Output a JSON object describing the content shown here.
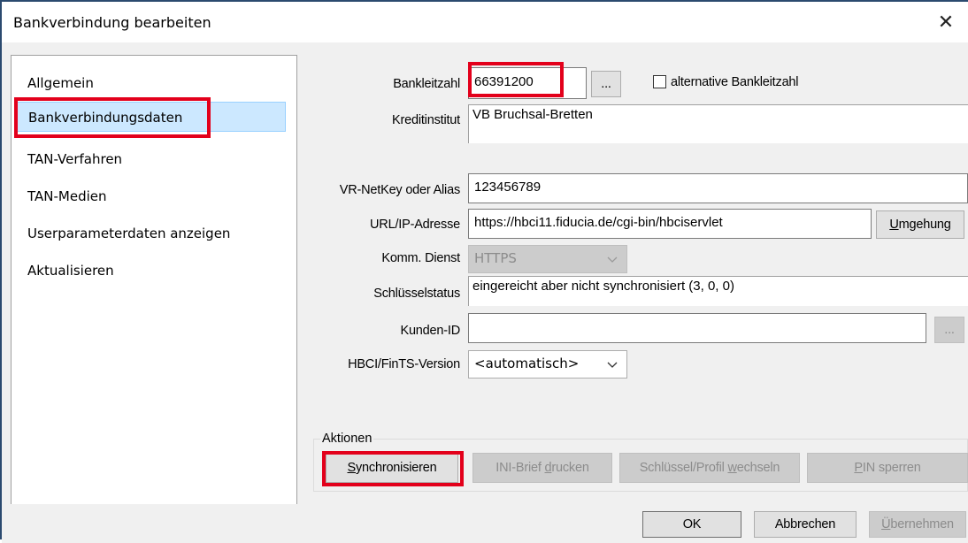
{
  "window": {
    "title": "Bankverbindung bearbeiten",
    "close_glyph": "✕"
  },
  "nav": {
    "items": [
      {
        "label": "Allgemein"
      },
      {
        "label": "Bankverbindungsdaten",
        "selected": true
      },
      {
        "label": "TAN-Verfahren"
      },
      {
        "label": "TAN-Medien"
      },
      {
        "label": "Userparameterdaten anzeigen"
      },
      {
        "label": "Aktualisieren"
      }
    ]
  },
  "form": {
    "blz_label": "Bankleitzahl",
    "blz_value": "66391200",
    "blz_browse": "...",
    "alt_blz_label": "alternative Bankleitzahl",
    "kreditinstitut_label": "Kreditinstitut",
    "kreditinstitut_value": "VB Bruchsal-Bretten",
    "netkey_label": "VR-NetKey oder Alias",
    "netkey_value": "123456789",
    "url_label": "URL/IP-Adresse",
    "url_value": "https://hbci11.fiducia.de/cgi-bin/hbciservlet",
    "umgehung_label": "Umgehung",
    "komm_label": "Komm. Dienst",
    "komm_value": "HTTPS",
    "schluessel_label": "Schlüsselstatus",
    "schluessel_value": "eingereicht aber nicht synchronisiert (3, 0, 0)",
    "kunden_label": "Kunden-ID",
    "kunden_value": "",
    "kunden_browse": "...",
    "hbci_label": "HBCI/FinTS-Version",
    "hbci_value": "<automatisch>"
  },
  "actions": {
    "group_label": "Aktionen",
    "sync": "Synchronisieren",
    "ini": "INI-Brief drucken",
    "wechseln": "Schlüssel/Profil wechseln",
    "pin": "PIN sperren"
  },
  "footer": {
    "ok": "OK",
    "cancel": "Abbrechen",
    "apply": "Übernehmen"
  },
  "colors": {
    "highlight": "#e3001b",
    "selection": "#cce8ff",
    "frame": "#2b4a6f"
  },
  "icons": {
    "chevron": "chevron-down-icon",
    "close": "close-icon"
  }
}
